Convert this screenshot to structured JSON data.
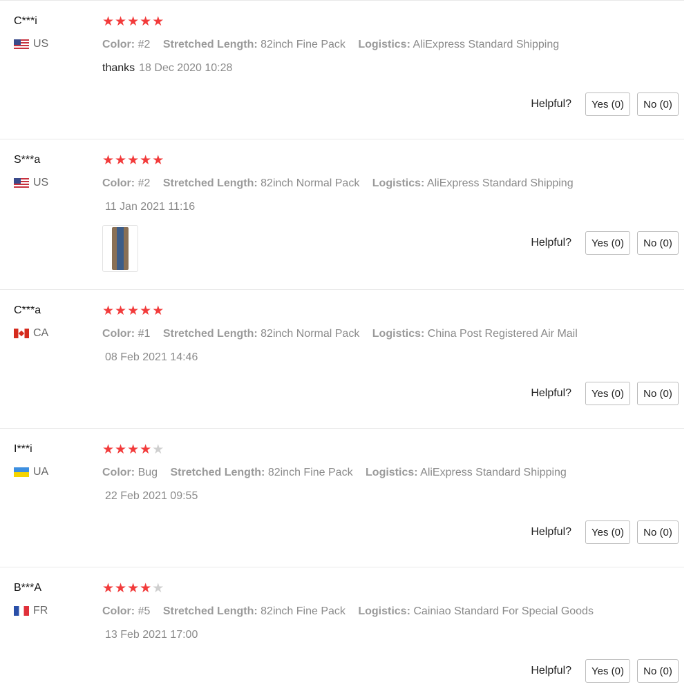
{
  "helpful_label": "Helpful?",
  "reviews": [
    {
      "user": "C***i",
      "country": "US",
      "flag": "flag-us",
      "stars": 5,
      "color_key": "Color:",
      "color_val": "#2",
      "length_key": "Stretched Length:",
      "length_val": "82inch Fine Pack",
      "log_key": "Logistics:",
      "log_val": "AliExpress Standard Shipping",
      "text": "thanks",
      "date": "18 Dec 2020 10:28",
      "yes": "Yes (0)",
      "no": "No (0)"
    },
    {
      "user": "S***a",
      "country": "US",
      "flag": "flag-us",
      "stars": 5,
      "color_key": "Color:",
      "color_val": "#2",
      "length_key": "Stretched Length:",
      "length_val": "82inch Normal Pack",
      "log_key": "Logistics:",
      "log_val": "AliExpress Standard Shipping",
      "text": "",
      "date": "11 Jan 2021 11:16",
      "has_photo": true,
      "yes": "Yes (0)",
      "no": "No (0)"
    },
    {
      "user": "C***a",
      "country": "CA",
      "flag": "flag-ca",
      "stars": 5,
      "color_key": "Color:",
      "color_val": "#1",
      "length_key": "Stretched Length:",
      "length_val": "82inch Normal Pack",
      "log_key": "Logistics:",
      "log_val": "China Post Registered Air Mail",
      "text": "",
      "date": "08 Feb 2021 14:46",
      "yes": "Yes (0)",
      "no": "No (0)"
    },
    {
      "user": "I***i",
      "country": "UA",
      "flag": "flag-ua",
      "stars": 4,
      "color_key": "Color:",
      "color_val": "Bug",
      "length_key": "Stretched Length:",
      "length_val": "82inch Fine Pack",
      "log_key": "Logistics:",
      "log_val": "AliExpress Standard Shipping",
      "text": "",
      "date": "22 Feb 2021 09:55",
      "yes": "Yes (0)",
      "no": "No (0)"
    },
    {
      "user": "B***A",
      "country": "FR",
      "flag": "flag-fr",
      "stars": 4,
      "color_key": "Color:",
      "color_val": "#5",
      "length_key": "Stretched Length:",
      "length_val": "82inch Fine Pack",
      "log_key": "Logistics:",
      "log_val": "Cainiao Standard For Special Goods",
      "text": "",
      "date": "13 Feb 2021 17:00",
      "yes": "Yes (0)",
      "no": "No (0)"
    }
  ],
  "colors": {
    "star_full": "#f23b3b",
    "star_empty": "#cfcfcf"
  }
}
